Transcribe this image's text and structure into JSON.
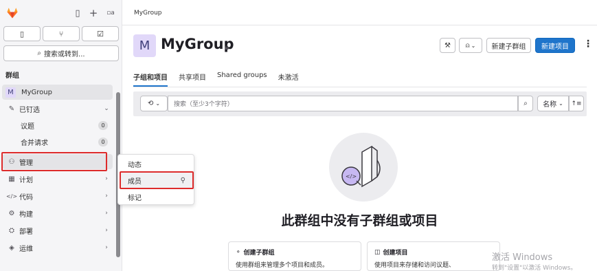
{
  "sidebar": {
    "top_icons": {
      "logo": "gitlab-logo",
      "toggle": "sidebar-toggle-icon",
      "create": "plus-icon",
      "avatar_alt": "a"
    },
    "shortcut_buttons": [
      {
        "icon": "issues-icon",
        "glyph": "▯"
      },
      {
        "icon": "merge-request-icon",
        "glyph": "⑂"
      },
      {
        "icon": "todo-icon",
        "glyph": "☑"
      }
    ],
    "search_label": "搜索或转到...",
    "section_title": "群组",
    "items": [
      {
        "label": "MyGroup",
        "avatar": "M"
      },
      {
        "label": "已钉选",
        "icon": "pin-icon",
        "glyph": "✎"
      },
      {
        "label": "议题",
        "count": "0"
      },
      {
        "label": "合并请求",
        "count": "0"
      },
      {
        "label": "管理",
        "icon": "users-icon",
        "glyph": "⚇"
      },
      {
        "label": "计划",
        "icon": "calendar-icon",
        "glyph": "▦"
      },
      {
        "label": "代码",
        "icon": "code-icon",
        "glyph": "</>"
      },
      {
        "label": "构建",
        "icon": "rocket-icon",
        "glyph": "⚙"
      },
      {
        "label": "部署",
        "icon": "deploy-icon",
        "glyph": "⛭"
      },
      {
        "label": "运维",
        "icon": "monitor-icon",
        "glyph": "◈"
      }
    ]
  },
  "flyout": {
    "items": [
      {
        "label": "动态"
      },
      {
        "label": "成员"
      },
      {
        "label": "标记"
      }
    ]
  },
  "main": {
    "breadcrumb": "MyGroup",
    "group_avatar": "M",
    "group_title": "MyGroup",
    "header_buttons": {
      "new_subgroup": "新建子群组",
      "new_project": "新建项目"
    },
    "tabs": [
      "子组和项目",
      "共享项目",
      "Shared groups",
      "未激活"
    ],
    "filter": {
      "placeholder": "搜索（至少3个字符）",
      "sort_label": "名称"
    },
    "empty_state": {
      "title": "此群组中没有子群组或项目",
      "cards": [
        {
          "title": "创建子群组",
          "desc": "使用群组来管理多个项目和成员。"
        },
        {
          "title": "创建项目",
          "desc": "使用项目来存储和访问议题、"
        }
      ]
    },
    "watermark": {
      "line1": "激活 Windows",
      "line2": "转到\"设置\"以激活 Windows。"
    }
  },
  "colors": {
    "accent": "#1f75cb",
    "highlight": "#dd2b2b",
    "sidebar_bg": "#f5f5f7"
  }
}
